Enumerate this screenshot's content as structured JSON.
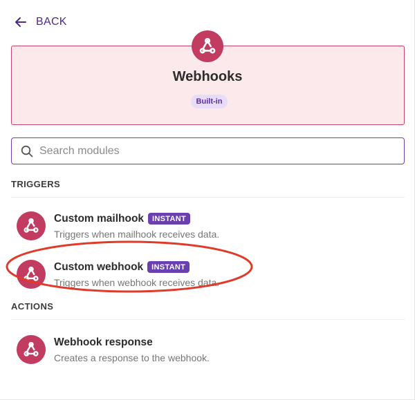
{
  "nav": {
    "back_label": "BACK"
  },
  "app": {
    "title": "Webhooks",
    "badge": "Built-in"
  },
  "search": {
    "placeholder": "Search modules",
    "value": ""
  },
  "sections": {
    "triggers": "TRIGGERS",
    "actions": "ACTIONS"
  },
  "modules": [
    {
      "title": "Custom mailhook",
      "badge": "INSTANT",
      "description": "Triggers when mailhook receives data."
    },
    {
      "title": "Custom webhook",
      "badge": "INSTANT",
      "description": "Triggers when webhook receives data."
    },
    {
      "title": "Webhook response",
      "badge": "",
      "description": "Creates a response to the webhook."
    }
  ],
  "colors": {
    "accent": "#6a3fb0",
    "brand": "#c23c62",
    "card_bg": "#fbe9ec",
    "highlight": "#e03a2a"
  },
  "icons": [
    "arrow-left-icon",
    "webhooks-logo-icon",
    "search-icon"
  ]
}
